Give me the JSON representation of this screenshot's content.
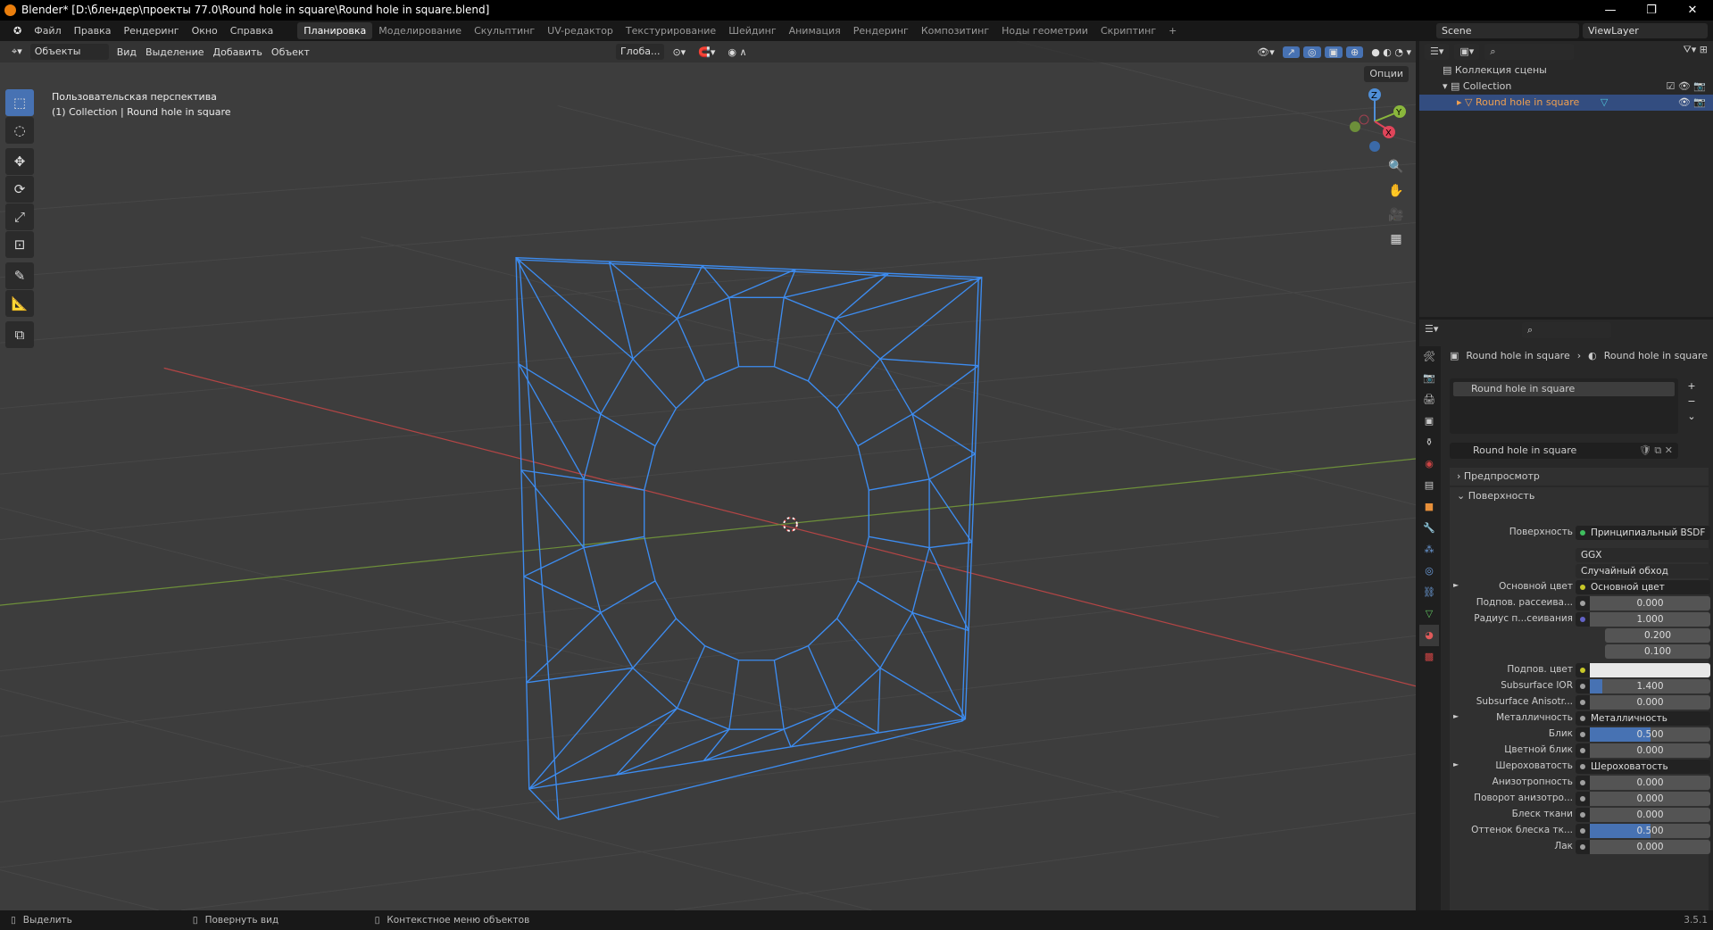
{
  "window": {
    "title": "Blender* [D:\\блендер\\проекты 77.0\\Round hole in square\\Round hole in square.blend]",
    "minimize": "—",
    "maximize": "❐",
    "close": "✕"
  },
  "menu": [
    "Файл",
    "Правка",
    "Рендеринг",
    "Окно",
    "Справка"
  ],
  "workspaces": [
    "Планировка",
    "Моделирование",
    "Скульптинг",
    "UV-редактор",
    "Текстурирование",
    "Шейдинг",
    "Анимация",
    "Рендеринг",
    "Композитинг",
    "Ноды геометрии",
    "Скриптинг",
    "+"
  ],
  "active_workspace": 0,
  "scene": {
    "name": "Scene",
    "view_layer": "ViewLayer"
  },
  "viewport": {
    "mode": "Объекты",
    "menus": [
      "Вид",
      "Выделение",
      "Добавить",
      "Объект"
    ],
    "orientation": "Глоба...",
    "options": "Опции",
    "view_name": "Пользовательская перспектива",
    "object_info": "(1) Collection | Round hole in square",
    "gizmo": {
      "z": "Z",
      "y": "Y",
      "x": "X"
    }
  },
  "outliner": {
    "scene_collection": "Коллекция сцены",
    "collection": "Collection",
    "object": "Round hole in square"
  },
  "properties": {
    "breadcrumb": [
      "Round hole in square",
      "Round hole in square"
    ],
    "slot": "Round hole in square",
    "material": "Round hole in square",
    "panels": {
      "preview": "Предпросмотр",
      "surface": "Поверхность"
    },
    "surface_label": "Поверхность",
    "surface_value": "Принципиальный BSDF",
    "distribution": "GGX",
    "subsurface_method": "Случайный обход",
    "rows": [
      {
        "label": "Основной цвет",
        "link": "Основной цвет",
        "dot": "#c7c729",
        "expand": "►"
      },
      {
        "label": "Подпов. рассеива...",
        "value": "0.000",
        "fill": 0
      },
      {
        "label": "Радиус п...сеивания",
        "value": "1.000",
        "fill": 0,
        "sock": "#6363c7"
      },
      {
        "label": "",
        "value": "0.200",
        "fill": 0
      },
      {
        "label": "",
        "value": "0.100",
        "fill": 0
      },
      {
        "label": "Подпов. цвет",
        "color": "#e8e8e8",
        "sock": "#c7c729"
      },
      {
        "label": "Subsurface IOR",
        "value": "1.400",
        "fill": 0.1
      },
      {
        "label": "Subsurface Anisotr...",
        "value": "0.000",
        "fill": 0
      },
      {
        "label": "Металличность",
        "link": "Металличность",
        "dot": "#a0a0a0",
        "expand": "►"
      },
      {
        "label": "Блик",
        "value": "0.500",
        "fill": 0.5
      },
      {
        "label": "Цветной блик",
        "value": "0.000",
        "fill": 0
      },
      {
        "label": "Шероховатость",
        "link": "Шероховатость",
        "dot": "#a0a0a0",
        "expand": "►"
      },
      {
        "label": "Анизотропность",
        "value": "0.000",
        "fill": 0
      },
      {
        "label": "Поворот анизотро...",
        "value": "0.000",
        "fill": 0
      },
      {
        "label": "Блеск ткани",
        "value": "0.000",
        "fill": 0
      },
      {
        "label": "Оттенок блеска тк...",
        "value": "0.500",
        "fill": 0.5
      },
      {
        "label": "Лак",
        "value": "0.000",
        "fill": 0
      }
    ]
  },
  "status": {
    "select": "Выделить",
    "rotate": "Повернуть вид",
    "context": "Контекстное меню объектов",
    "version": "3.5.1"
  },
  "colors": {
    "accent": "#4772b3",
    "wire": "#3d8cf0",
    "x_axis": "#b34545",
    "y_axis": "#6d8f3a"
  }
}
